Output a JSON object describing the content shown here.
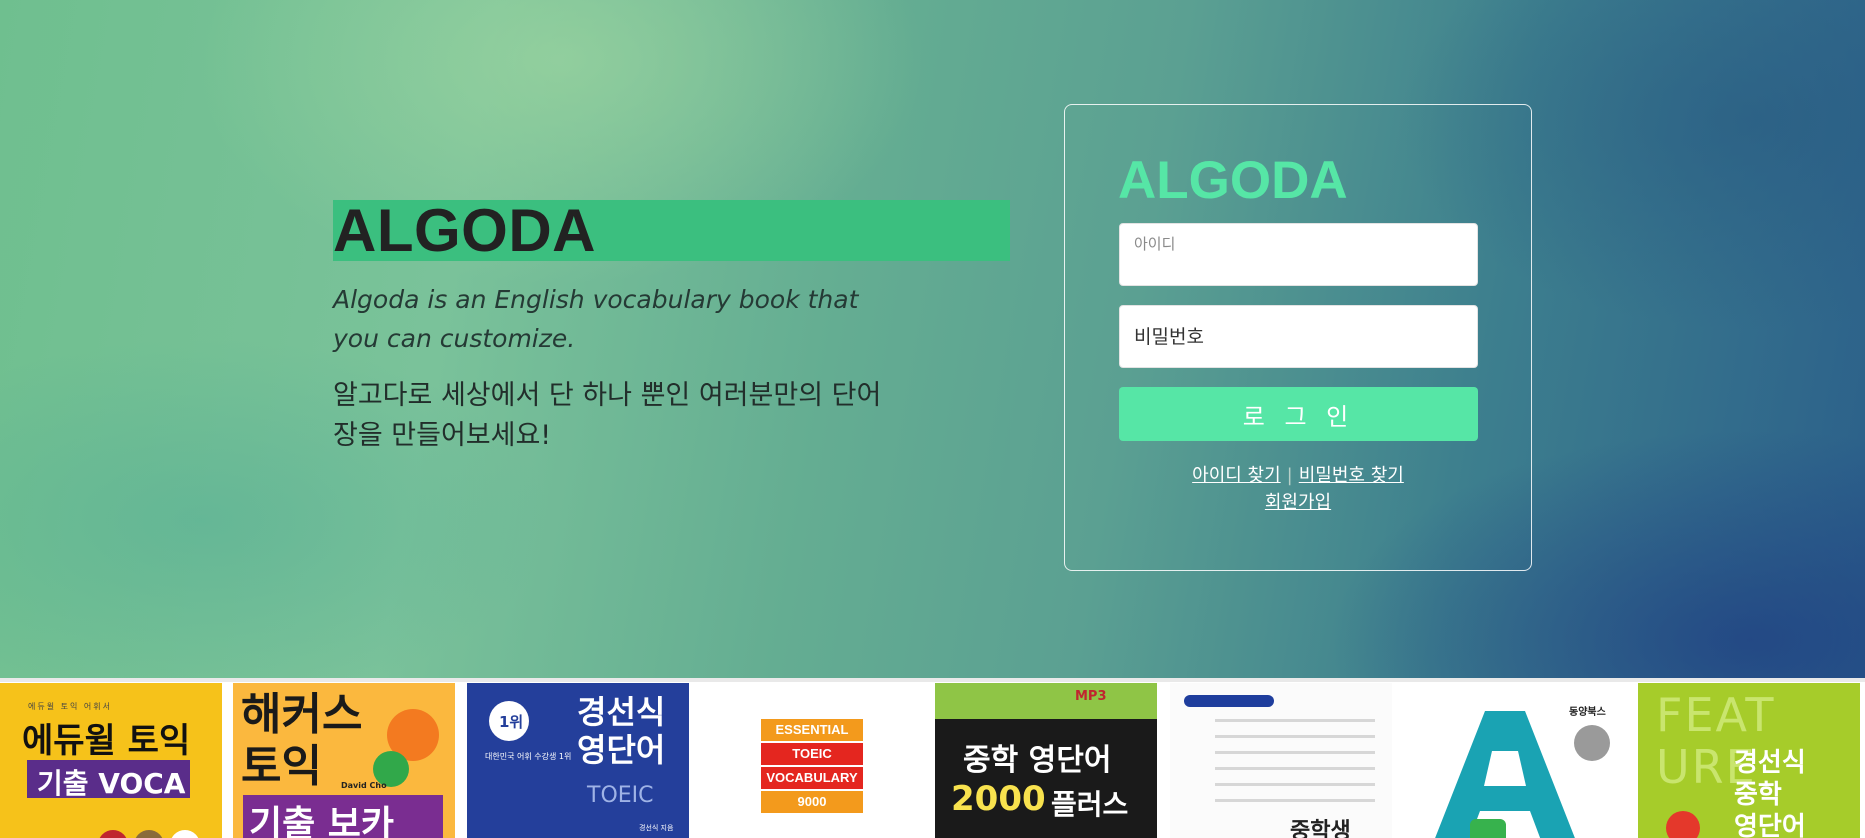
{
  "hero": {
    "title": "ALGODA",
    "tagline_en": "Algoda is an English vocabulary book that you can customize.",
    "tagline_ko": "알고다로 세상에서 단 하나 뿐인 여러분만의 단어장을 만들어보세요!"
  },
  "login": {
    "logo": "ALGODA",
    "id_placeholder": "아이디",
    "password_placeholder": "비밀번호",
    "submit_label": "로 그 인",
    "find_id": "아이디 찾기",
    "separator": "|",
    "find_password": "비밀번호 찾기",
    "signup": "회원가입"
  },
  "books": [
    {
      "small": "에듀윌 토익 어휘서",
      "title": "에듀윌 토익",
      "subtitle": "기출 VOCA",
      "color": "#f6c21a"
    },
    {
      "title": "해커스\n토익",
      "subtitle": "기출 보카",
      "author": "David Cho",
      "color": "#fbb83e"
    },
    {
      "rank": "1위",
      "caption": "대한민국 어휘 수강생 1위",
      "title": "경선식\n영단어",
      "subtitle": "TOEIC",
      "author": "경선식 지음",
      "color": "#243f9b"
    },
    {
      "rows": [
        "ESSENTIAL",
        "TOEIC",
        "VOCABULARY",
        "9000"
      ],
      "color": "#ffffff"
    },
    {
      "badge": "MP3",
      "title": "중학 영단어",
      "number": "2000",
      "plus": "플러스",
      "color": "#8fc546"
    },
    {
      "title": "중학생",
      "color": "#fbfbfb"
    },
    {
      "brand": "동양북스",
      "color": "#ffffff"
    },
    {
      "feat": "FEAT\nURE",
      "title": "경선식\n중학\n영단어",
      "color": "#a6cc2a"
    }
  ]
}
